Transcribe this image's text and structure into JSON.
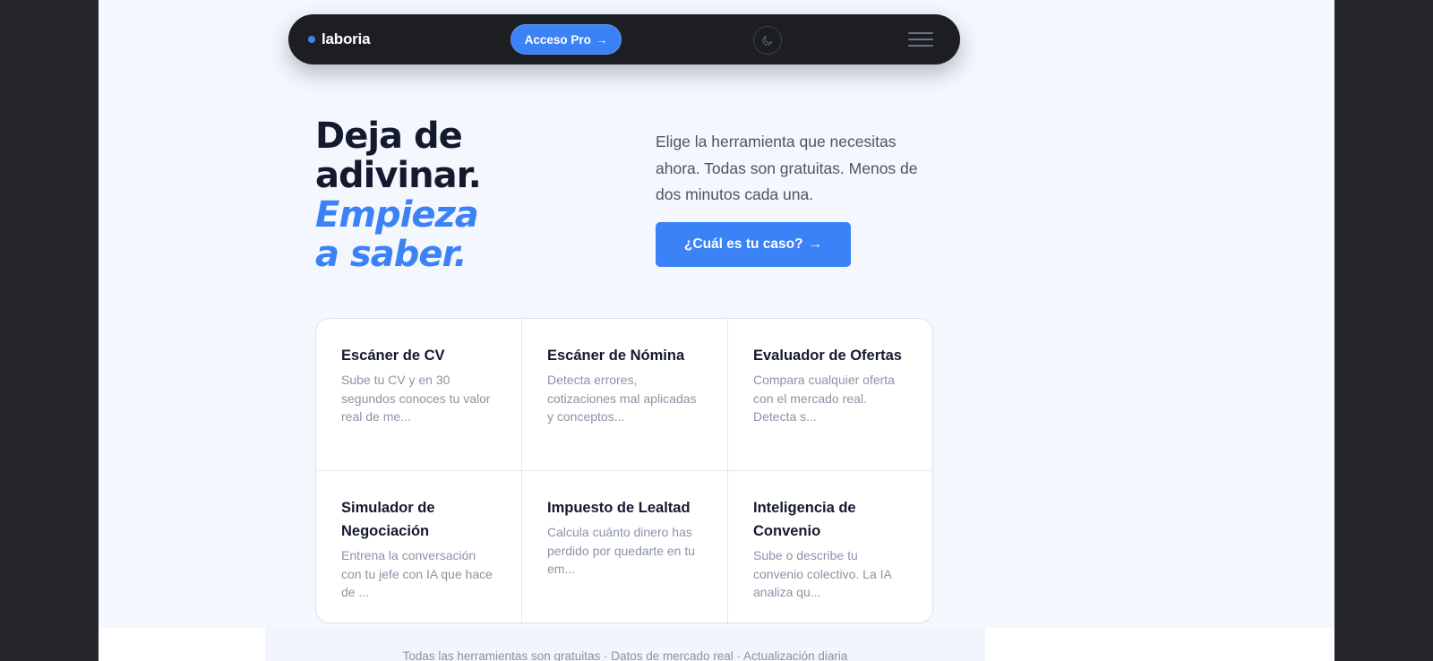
{
  "nav": {
    "logo_text": "laboria",
    "pro_button": "Acceso Pro",
    "pro_arrow": "→",
    "theme_icon": "moon-icon",
    "menu_icon": "hamburger-menu-icon"
  },
  "hero": {
    "title_line1": "Deja de",
    "title_line2": "adivinar.",
    "title_accent_line1": "Empieza",
    "title_accent_line2": "a saber.",
    "description": "Elige la herramienta que necesitas ahora. Todas son gratuitas. Menos de dos minutos cada una.",
    "cta_label": "¿Cuál es tu caso?",
    "cta_arrow": "→"
  },
  "tools": [
    {
      "title": "Escáner de CV",
      "description": "Sube tu CV y en 30 segundos conoces tu valor real de me..."
    },
    {
      "title": "Escáner de Nómina",
      "description": "Detecta errores, cotizaciones mal aplicadas y conceptos..."
    },
    {
      "title": "Evaluador de Ofertas",
      "description": "Compara cualquier oferta con el mercado real. Detecta s..."
    },
    {
      "title": "Simulador de Negociación",
      "description": "Entrena la conversación con tu jefe con IA que hace de ..."
    },
    {
      "title": "Impuesto de Lealtad",
      "description": "Calcula cuánto dinero has perdido por quedarte en tu em..."
    },
    {
      "title": "Inteligencia de Convenio",
      "description": "Sube o describe tu convenio colectivo. La IA analiza qu..."
    }
  ],
  "footer": {
    "text": "Todas las herramientas son gratuitas · Datos de mercado real · Actualización diaria"
  },
  "colors": {
    "accent": "#3b82f6",
    "nav_background": "#1d1e22",
    "page_background": "#f4f7fd",
    "text_dark": "#141a2e"
  }
}
